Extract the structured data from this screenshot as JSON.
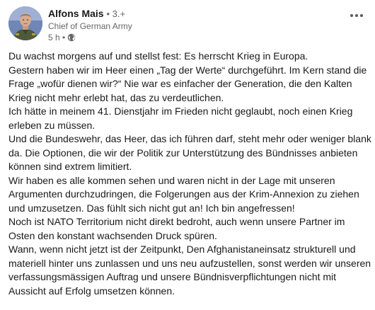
{
  "post": {
    "author": {
      "name": "Alfons Mais",
      "degree": "• 3.+",
      "headline": "Chief of German Army",
      "time": "5 h •",
      "visibility_icon": "globe-icon"
    },
    "more_icon": "more-horizontal-icon",
    "lines": [
      "Du wachst morgens auf und stellst fest: Es herrscht Krieg in Europa.",
      "Gestern haben wir im Heer einen „Tag der Werte“ durchgeführt. Im Kern stand die",
      "Frage „wofür dienen wir?“ Nie war es einfacher der Generation, die den Kalten",
      "Krieg nicht mehr erlebt hat, das zu verdeutlichen.",
      "Ich hätte in meinem 41. Dienstjahr im Frieden nicht geglaubt, noch einen Krieg",
      "erleben zu müssen.",
      "Und die Bundeswehr, das Heer, das ich führen darf, steht mehr oder weniger blank",
      "da. Die Optionen, die wir der Politik zur Unterstützung des Bündnisses anbieten",
      "können sind extrem limitiert.",
      "Wir haben es alle kommen sehen und waren nicht in der Lage mit unseren",
      "Argumenten durchzudringen, die Folgerungen aus der Krim-Annexion zu ziehen",
      "und umzusetzen. Das fühlt sich nicht gut an! Ich bin angefressen!",
      "Noch ist NATO Territorium nicht direkt bedroht, auch wenn unsere Partner im",
      "Osten den konstant wachsenden Druck spüren.",
      "Wann, wenn nicht jetzt ist der Zeitpunkt, Den Afghanistaneinsatz strukturell und",
      "materiell hinter uns zunlassen und uns neu aufzustellen, sonst werden wir unseren",
      "verfassungsmässigen Auftrag und unsere Bündnisverpflichtungen nicht mit",
      "Aussicht auf Erfolg umsetzen können."
    ]
  }
}
